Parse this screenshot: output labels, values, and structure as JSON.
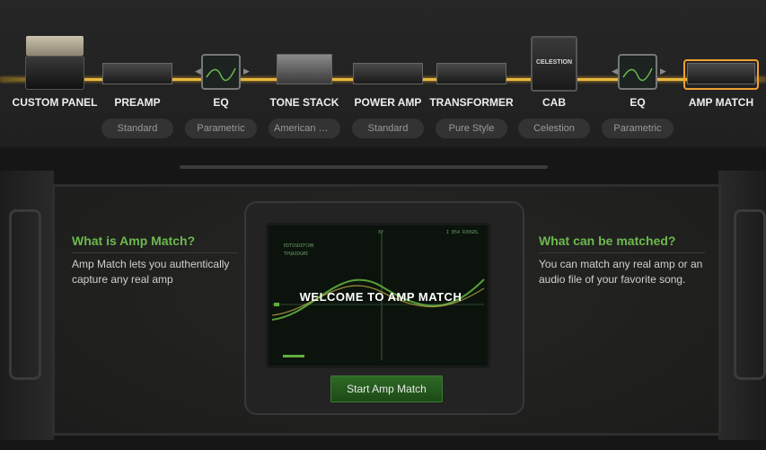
{
  "chain": {
    "modules": [
      {
        "label": "CUSTOM PANEL",
        "preset": ""
      },
      {
        "label": "PREAMP",
        "preset": "Standard"
      },
      {
        "label": "EQ",
        "preset": "Parametric"
      },
      {
        "label": "TONE STACK",
        "preset": "American Cl..."
      },
      {
        "label": "POWER AMP",
        "preset": "Standard"
      },
      {
        "label": "TRANSFORMER",
        "preset": "Pure Style"
      },
      {
        "label": "CAB",
        "preset": "Celestion"
      },
      {
        "label": "EQ",
        "preset": "Parametric"
      },
      {
        "label": "AMP MATCH",
        "preset": ""
      }
    ],
    "cab_brand": "CELESTION",
    "selected": "AMP MATCH",
    "accent_color": "#e8b93c",
    "selected_color": "#f0a030"
  },
  "left_info": {
    "title": "What is Amp Match?",
    "text": "Amp Match lets you authentically capture any real amp"
  },
  "right_info": {
    "title": "What can be matched?",
    "text": "You can match any real amp or an audio file of your favorite song."
  },
  "screen": {
    "welcome": "WELCOME TO AMP MATCH",
    "axis_label": "XY",
    "corner_top_right": "I B54 R30GEL",
    "corner_line1": "EDTSSDIFCRN",
    "corner_line2": "TPQAIDGMI",
    "graph_color": "#5fae3f"
  },
  "start_button": {
    "label": "Start Amp Match"
  }
}
